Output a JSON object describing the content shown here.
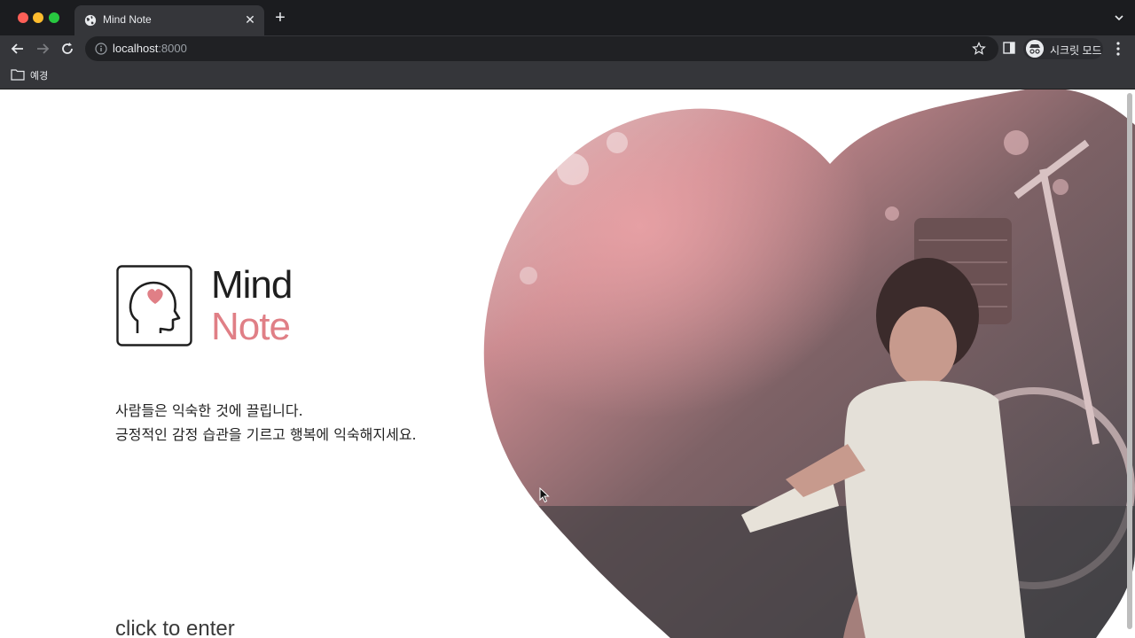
{
  "window": {
    "tab_title": "Mind Note",
    "tab_icon": "globe-icon",
    "close_symbol": "✕",
    "new_tab_symbol": "+"
  },
  "toolbar": {
    "url_host": "localhost",
    "url_port": ":8000",
    "incognito_label": "시크릿 모드"
  },
  "bookmarks": {
    "items": [
      {
        "label": "예경",
        "icon": "folder-icon"
      }
    ]
  },
  "page": {
    "logo_top": "Mind",
    "logo_bottom": "Note",
    "tagline_1": "사람들은 익숙한 것에 끌립니다.",
    "tagline_2": "긍정적인 감정 습관을 기르고 행복에 익숙해지세요.",
    "enter_label": "click to enter"
  },
  "colors": {
    "accent": "#e07f86",
    "titlebar": "#1b1c1f",
    "toolbar": "#35363a"
  }
}
